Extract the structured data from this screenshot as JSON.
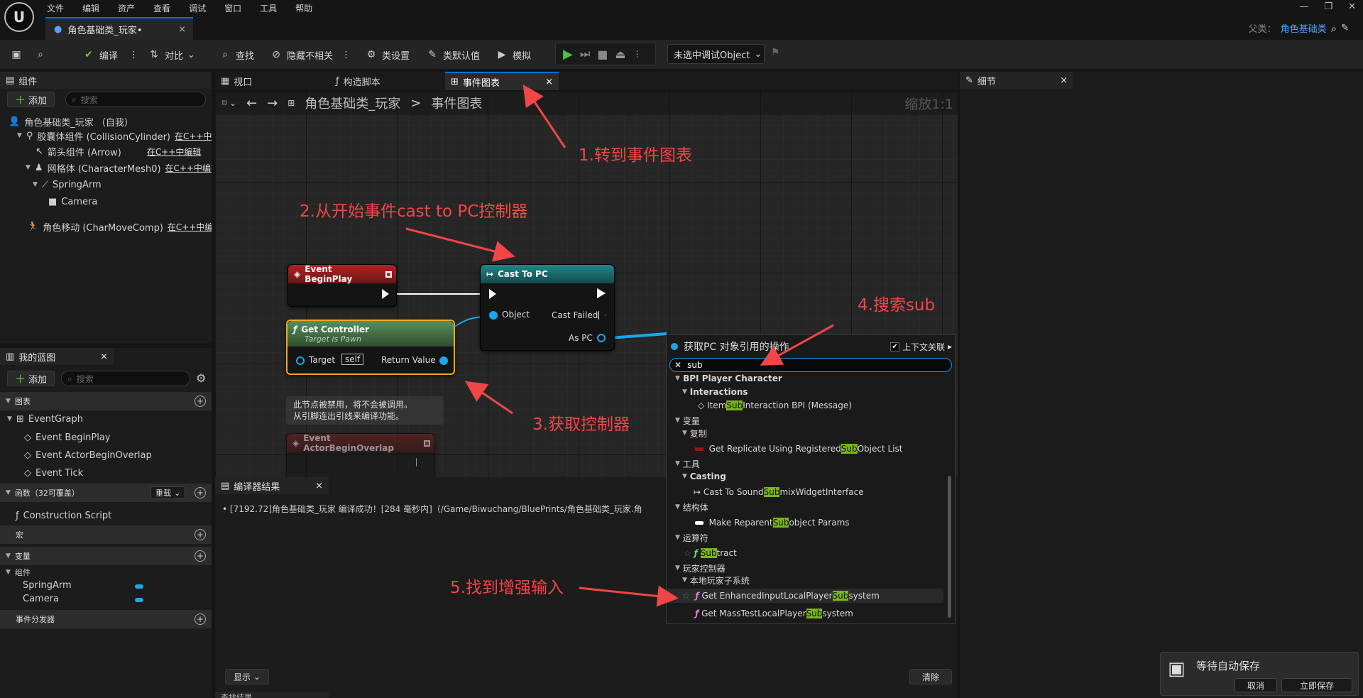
{
  "menu": [
    "文件",
    "编辑",
    "资产",
    "查看",
    "调试",
    "窗口",
    "工具",
    "帮助"
  ],
  "logo": "U",
  "doc_tab": {
    "title": "角色基础类_玩家•",
    "close": "×"
  },
  "parent": {
    "label": "父类：",
    "value": "角色基础类"
  },
  "toolbar": {
    "compile": "编译",
    "diff": "对比",
    "find": "查找",
    "hide_unrelated": "隐藏不相关",
    "class_settings": "类设置",
    "class_defaults": "类默认值",
    "simulate": "模拟",
    "debug_object": "未选中调试Object"
  },
  "components_panel": {
    "title": "组件",
    "add": "添加",
    "search_placeholder": "搜索",
    "items": [
      {
        "label": "角色基础类_玩家 （自我）",
        "edit": ""
      },
      {
        "label": "胶囊体组件 (CollisionCylinder)",
        "edit": "在C++中编"
      },
      {
        "label": "箭头组件 (Arrow)",
        "edit": "在C++中编辑"
      },
      {
        "label": "网格体 (CharacterMesh0)",
        "edit": "在C++中编辑"
      },
      {
        "label": "SpringArm",
        "edit": ""
      },
      {
        "label": "Camera",
        "edit": ""
      },
      {
        "label": "角色移动 (CharMoveComp)",
        "edit": "在C++中编辑"
      }
    ]
  },
  "my_blueprint": {
    "title": "我的蓝图",
    "add": "添加",
    "search_placeholder": "搜索",
    "graphs_label": "图表",
    "event_graph": "EventGraph",
    "events": [
      "Event BeginPlay",
      "Event ActorBeginOverlap",
      "Event Tick"
    ],
    "functions_label": "函数（32可覆盖）",
    "override": "重载",
    "construction": "Construction Script",
    "macros_label": "宏",
    "variables_label": "变量",
    "components_label": "组件",
    "variables": [
      "SpringArm",
      "Camera"
    ],
    "dispatchers_label": "事件分发器"
  },
  "graph_tabs": [
    "视口",
    "构造脚本",
    "事件图表"
  ],
  "breadcrumb": {
    "root": "角色基础类_玩家",
    "sep": ">",
    "current": "事件图表",
    "zoom": "缩放1:1"
  },
  "nodes": {
    "begin_play": "Event BeginPlay",
    "cast_title": "Cast To PC",
    "cast_object": "Object",
    "cast_failed": "Cast Failed",
    "as_pc": "As PC",
    "get_controller": "Get Controller",
    "get_controller_sub": "Target is Pawn",
    "target": "Target",
    "self": "self",
    "return_value": "Return Value",
    "disabled_note_1": "此节点被禁用，将不会被调用。",
    "disabled_note_2": "从引脚连出引线来编译功能。",
    "overlap": "Event ActorBeginOverlap"
  },
  "annotations": [
    "1.转到事件图表",
    "2.从开始事件cast to PC控制器",
    "3.获取控制器",
    "4.搜索sub",
    "5.找到增强输入"
  ],
  "context_menu": {
    "title": "获取PC 对象引用的操作",
    "context_sensitive": "上下文关联",
    "query": "sub",
    "items": [
      {
        "pre": "BPI Player Character",
        "hl": "",
        "post": ""
      },
      {
        "pre": "Interactions",
        "hl": "",
        "post": ""
      },
      {
        "pre": "Item ",
        "hl": "Sub",
        "post": " Interaction BPI (Message)"
      },
      {
        "pre": "变量",
        "hl": "",
        "post": ""
      },
      {
        "pre": "复制",
        "hl": "",
        "post": ""
      },
      {
        "pre": "Get Replicate Using Registered ",
        "hl": "Sub",
        "post": " Object List"
      },
      {
        "pre": "工具",
        "hl": "",
        "post": ""
      },
      {
        "pre": "Casting",
        "hl": "",
        "post": ""
      },
      {
        "pre": "Cast To Sound",
        "hl": "Sub",
        "post": "mixWidgetInterface"
      },
      {
        "pre": "结构体",
        "hl": "",
        "post": ""
      },
      {
        "pre": "Make Reparent ",
        "hl": "Sub",
        "post": "object Params"
      },
      {
        "pre": "运算符",
        "hl": "",
        "post": ""
      },
      {
        "pre": "",
        "hl": "Sub",
        "post": "tract"
      },
      {
        "pre": "玩家控制器",
        "hl": "",
        "post": ""
      },
      {
        "pre": "本地玩家子系统",
        "hl": "",
        "post": ""
      },
      {
        "pre": "Get EnhancedInputLocalPlayer",
        "hl": "Sub",
        "post": "system"
      },
      {
        "pre": "Get MassTestLocalPlayer",
        "hl": "Sub",
        "post": "system"
      }
    ]
  },
  "compiler": {
    "title": "编译器结果",
    "message": "[7192.72]角色基础类_玩家 编译成功！[284 毫秒内]（/Game/Biwuchang/BluePrints/角色基础类_玩家.角",
    "show": "显示",
    "clear": "清除",
    "find_results": "查找结果"
  },
  "details": {
    "title": "细节"
  },
  "autosave": {
    "text": "等待自动保存",
    "cancel": "取消",
    "save_now": "立即保存"
  },
  "colors": {
    "accent": "#0070e0",
    "event_red": "#8c1d1d",
    "cast_teal": "#1e6e72",
    "pure_green": "#3d6b3d",
    "annotation": "#f04646",
    "highlight": "#7ab51d"
  }
}
